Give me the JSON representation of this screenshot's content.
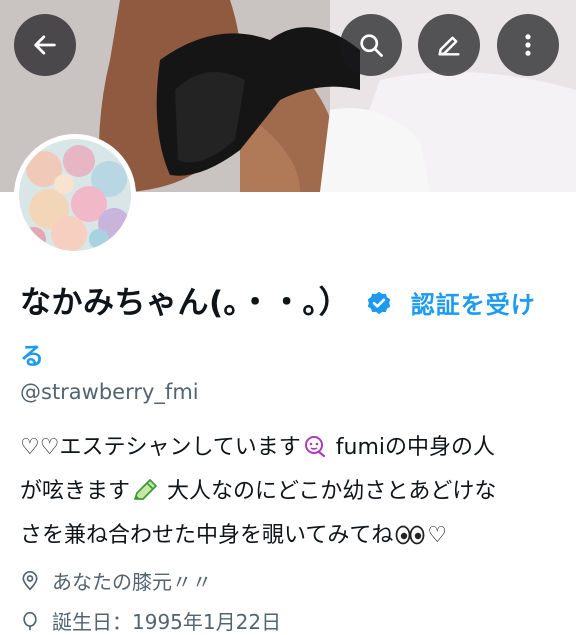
{
  "header": {
    "back_icon": "arrow-left-icon",
    "search_icon": "search-icon",
    "edit_icon": "pencil-icon",
    "more_icon": "more-vertical-icon"
  },
  "profile": {
    "display_name": "なかみちゃん(｡・・｡）",
    "verified_icon": "verified-badge-icon",
    "get_verified_label": "認証を受ける",
    "handle": "@strawberry_fmi",
    "bio": {
      "line1_part1": "♡♡エステシャンしています",
      "line1_part2": " fumiの中身の人",
      "line2_part1": "が呟きます",
      "line2_part2": " 大人なのにどこか幼さとあどけな",
      "line3": "さを兼ね合わせた中身を覗いてみてね",
      "line3_end": "♡"
    },
    "location": "あなたの膝元〃〃",
    "birth_date_partial": "誕生日：1995年1月22日"
  },
  "colors": {
    "accent": "#1d9bf0",
    "secondary_text": "#536471",
    "button_bg": "#19191c"
  }
}
